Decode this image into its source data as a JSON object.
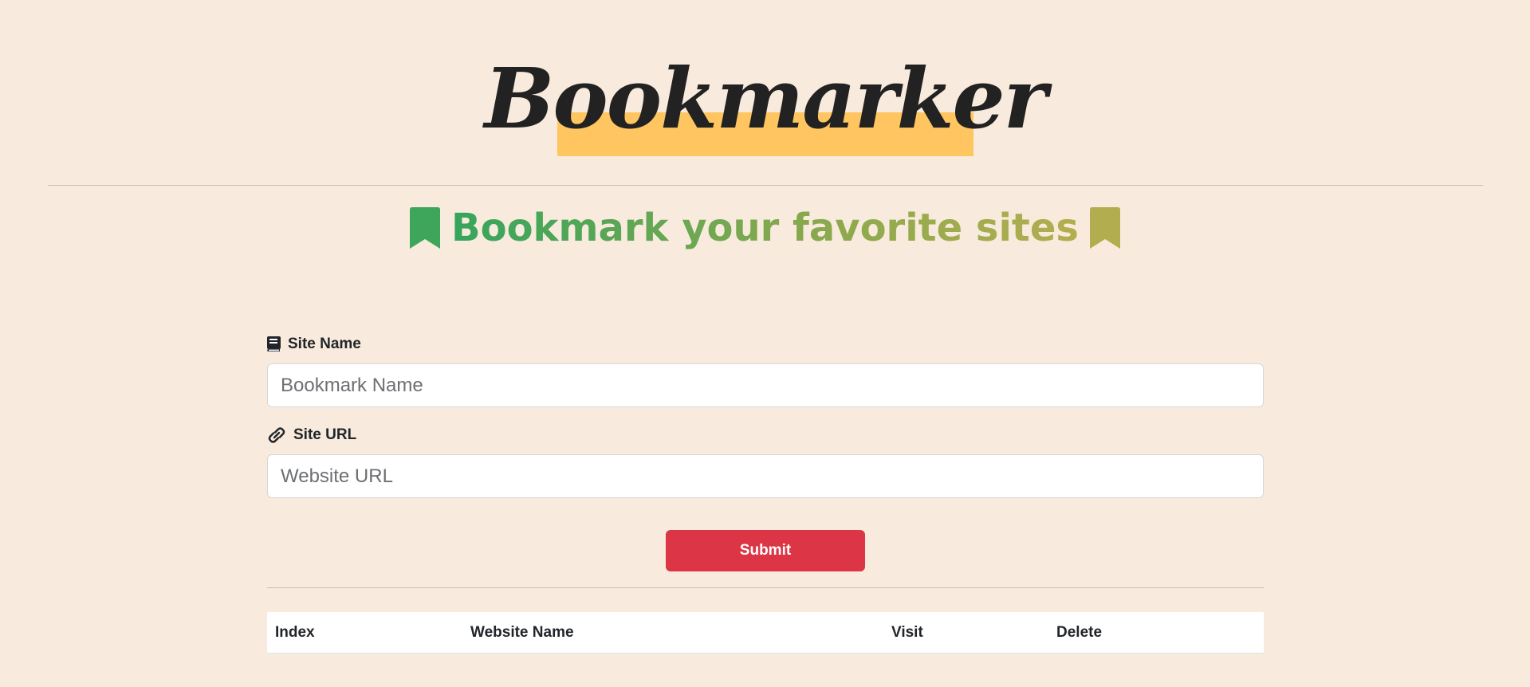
{
  "header": {
    "logo_text": "Bookmarker",
    "tagline": "Bookmark your favorite sites"
  },
  "form": {
    "site_name_label": "Site Name",
    "site_name_placeholder": "Bookmark Name",
    "site_name_value": "",
    "site_url_label": "Site URL",
    "site_url_placeholder": "Website URL",
    "site_url_value": "",
    "submit_label": "Submit"
  },
  "table": {
    "columns": [
      "Index",
      "Website Name",
      "Visit",
      "Delete"
    ],
    "rows": []
  },
  "icons": {
    "tagline_left": "bookmark-icon",
    "tagline_right": "bookmark-icon",
    "site_name": "book-icon",
    "site_url": "link-icon"
  },
  "colors": {
    "background": "#f8ebdd",
    "logo_highlight": "#fec560",
    "submit": "#dc3545",
    "tagline_start": "#35a55c",
    "tagline_end": "#b3ae4f"
  }
}
